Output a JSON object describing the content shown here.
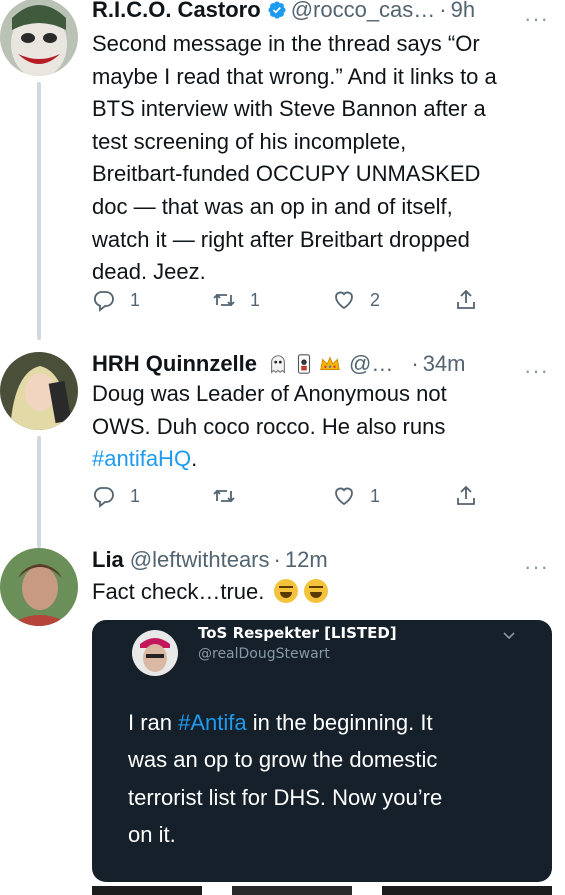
{
  "tweets": [
    {
      "author": {
        "name": "R.I.C.O. Castoro",
        "handle": "@rocco_cas…",
        "verified": true
      },
      "time": "9h",
      "text_lines": [
        "Second message in the thread says “Or",
        "maybe I read that wrong.” And it links to a",
        "BTS interview with Steve Bannon after a",
        "test screening of his incomplete,",
        "Breitbart-funded OCCUPY UNMASKED",
        "doc — that was an op in and of itself,",
        "watch it — right after Breitbart dropped",
        "dead. Jeez."
      ],
      "actions": {
        "reply_count": "1",
        "retweet_count": "1",
        "like_count": "2"
      }
    },
    {
      "author": {
        "name": "HRH Quinnzelle",
        "handle": "@…",
        "emojis": [
          "ghost",
          "playing-card",
          "crown"
        ]
      },
      "time": "34m",
      "text_lines": [
        "Doug was Leader of Anonymous not",
        "OWS. Duh coco rocco. He also runs"
      ],
      "hashtag": "#antifaHQ",
      "hashtag_suffix": ".",
      "actions": {
        "reply_count": "1",
        "retweet_count": "",
        "like_count": "1"
      }
    },
    {
      "author": {
        "name": "Lia",
        "handle": "@leftwithtears"
      },
      "time": "12m",
      "text": "Fact check…true.",
      "text_emojis": [
        "grinning-squinting",
        "grinning-squinting"
      ],
      "embedded": {
        "name": "ToS Respekter [LISTED]",
        "handle": "@realDougStewart",
        "text_lines": [
          {
            "prefix": "I ran ",
            "hashtag": "#Antifa",
            "suffix": " in the beginning. It"
          },
          {
            "text": "was an op to grow the domestic"
          },
          {
            "text": "terrorist list for DHS. Now you’re"
          },
          {
            "text": "on it."
          }
        ]
      }
    }
  ],
  "ui": {
    "dot": "·",
    "more": "···"
  },
  "colors": {
    "link": "#1d9bf0",
    "secondary_text": "#536471",
    "card_background": "#15202b",
    "thread_line": "#cfd9de"
  }
}
